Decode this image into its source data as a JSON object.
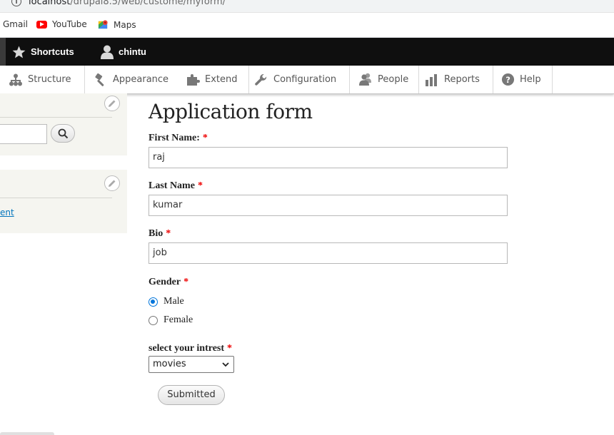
{
  "browser": {
    "url_host": "localhost",
    "url_path": "/drupal8.5/web/custome/myform/",
    "bookmarks": [
      {
        "label": "Gmail"
      },
      {
        "label": "YouTube"
      },
      {
        "label": "Maps"
      }
    ]
  },
  "toolbar": {
    "shortcuts": "Shortcuts",
    "user": "chintu"
  },
  "admin_menu": {
    "structure": "Structure",
    "appearance": "Appearance",
    "extend": "Extend",
    "configuration": "Configuration",
    "people": "People",
    "reports": "Reports",
    "help": "Help"
  },
  "sidebar": {
    "link_text": "ent"
  },
  "form": {
    "title": "Application form",
    "first_name_label": "First Name:",
    "first_name_value": "raj",
    "last_name_label": "Last Name",
    "last_name_value": "kumar",
    "bio_label": "Bio",
    "bio_value": "job",
    "gender_label": "Gender",
    "gender_options": [
      {
        "label": "Male",
        "checked": true
      },
      {
        "label": "Female",
        "checked": false
      }
    ],
    "interest_label": "select your intrest",
    "interest_value": "movies",
    "required_mark": "*",
    "submit_label": "Submitted"
  },
  "colors": {
    "toolbar_bg": "#0f0f0f",
    "required": "#e00000",
    "link": "#0074bd",
    "radio_accent": "#0075db"
  }
}
